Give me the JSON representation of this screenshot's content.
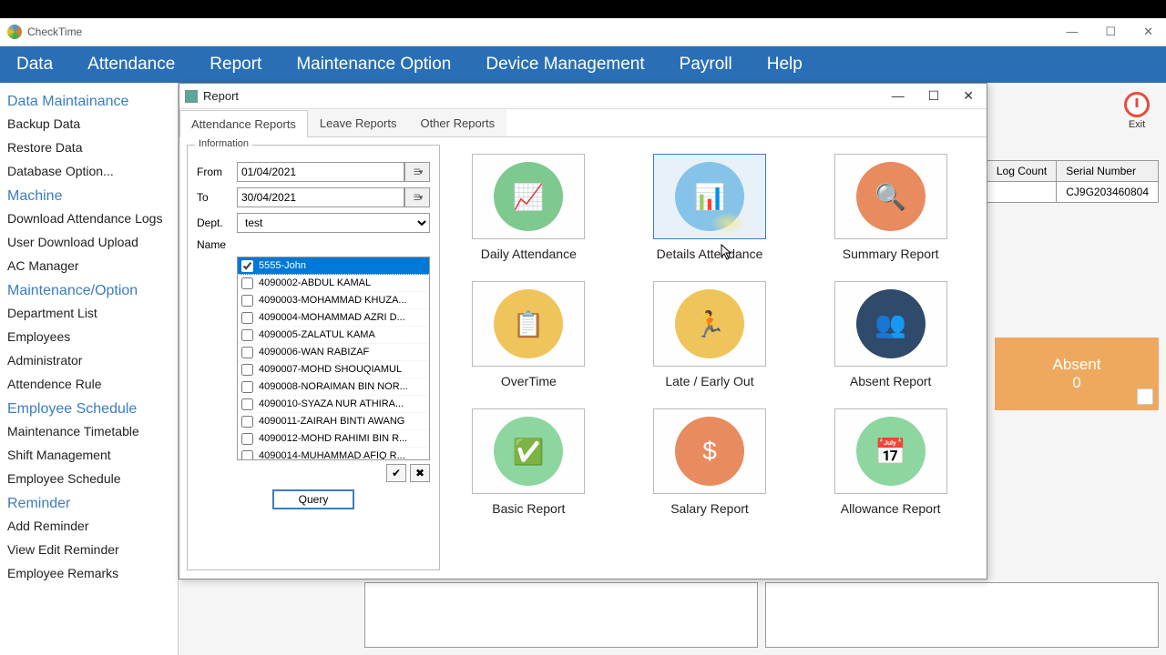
{
  "app": {
    "title": "CheckTime"
  },
  "menubar": [
    "Data",
    "Attendance",
    "Report",
    "Maintenance Option",
    "Device Management",
    "Payroll",
    "Help"
  ],
  "sidebar": [
    {
      "type": "head",
      "label": "Data Maintainance"
    },
    {
      "type": "item",
      "label": "Backup Data"
    },
    {
      "type": "item",
      "label": "Restore Data"
    },
    {
      "type": "item",
      "label": "Database Option..."
    },
    {
      "type": "head",
      "label": "Machine"
    },
    {
      "type": "item",
      "label": "Download Attendance Logs"
    },
    {
      "type": "item",
      "label": "User Download Upload"
    },
    {
      "type": "item",
      "label": "AC Manager"
    },
    {
      "type": "head",
      "label": "Maintenance/Option"
    },
    {
      "type": "item",
      "label": "Department List"
    },
    {
      "type": "item",
      "label": "Employees"
    },
    {
      "type": "item",
      "label": "Administrator"
    },
    {
      "type": "item",
      "label": "Attendence Rule"
    },
    {
      "type": "head",
      "label": "Employee Schedule"
    },
    {
      "type": "item",
      "label": "Maintenance Timetable"
    },
    {
      "type": "item",
      "label": "Shift Management"
    },
    {
      "type": "item",
      "label": "Employee Schedule"
    },
    {
      "type": "head",
      "label": "Reminder"
    },
    {
      "type": "item",
      "label": "Add Reminder"
    },
    {
      "type": "item",
      "label": "View Edit Reminder"
    },
    {
      "type": "item",
      "label": "Employee Remarks"
    }
  ],
  "exit": {
    "label": "Exit"
  },
  "bgtable": {
    "cols": [
      "Log Count",
      "Serial Number"
    ],
    "row": [
      "",
      "CJ9G203460804"
    ]
  },
  "absent": {
    "title": "Absent",
    "count": "0"
  },
  "modal": {
    "title": "Report",
    "tabs": [
      "Attendance Reports",
      "Leave Reports",
      "Other Reports"
    ],
    "activeTab": 0,
    "info": {
      "legend": "Information",
      "fromLabel": "From",
      "fromValue": "01/04/2021",
      "toLabel": "To",
      "toValue": "30/04/2021",
      "deptLabel": "Dept.",
      "deptValue": "test",
      "nameLabel": "Name",
      "names": [
        {
          "checked": true,
          "selected": true,
          "label": "5555-John"
        },
        {
          "checked": false,
          "selected": false,
          "label": "4090002-ABDUL KAMAL"
        },
        {
          "checked": false,
          "selected": false,
          "label": "4090003-MOHAMMAD KHUZA..."
        },
        {
          "checked": false,
          "selected": false,
          "label": "4090004-MOHAMMAD AZRI D..."
        },
        {
          "checked": false,
          "selected": false,
          "label": "4090005-ZALATUL KAMA"
        },
        {
          "checked": false,
          "selected": false,
          "label": "4090006-WAN RABIZAF"
        },
        {
          "checked": false,
          "selected": false,
          "label": "4090007-MOHD SHOUQIAMUL"
        },
        {
          "checked": false,
          "selected": false,
          "label": "4090008-NORAIMAN BIN NOR..."
        },
        {
          "checked": false,
          "selected": false,
          "label": "4090010-SYAZA NUR ATHIRA..."
        },
        {
          "checked": false,
          "selected": false,
          "label": "4090011-ZAIRAH BINTI AWANG"
        },
        {
          "checked": false,
          "selected": false,
          "label": "4090012-MOHD RAHIMI BIN R..."
        },
        {
          "checked": false,
          "selected": false,
          "label": "4090014-MUHAMMAD AFIQ R..."
        }
      ],
      "queryLabel": "Query"
    },
    "reports": [
      {
        "label": "Daily Attendance",
        "color": "c-green",
        "glyph": "📈"
      },
      {
        "label": "Details Attendance",
        "color": "c-blue",
        "glyph": "📊",
        "hover": true
      },
      {
        "label": "Summary Report",
        "color": "c-orange",
        "glyph": "🔍"
      },
      {
        "label": "OverTime",
        "color": "c-yellow",
        "glyph": "📋"
      },
      {
        "label": "Late / Early Out",
        "color": "c-yellow",
        "glyph": "🏃"
      },
      {
        "label": "Absent Report",
        "color": "c-navy",
        "glyph": "👥"
      },
      {
        "label": "Basic Report",
        "color": "c-lgreen",
        "glyph": "✅"
      },
      {
        "label": "Salary Report",
        "color": "c-orange",
        "glyph": "$"
      },
      {
        "label": "Allowance Report",
        "color": "c-lgreen",
        "glyph": "📅"
      }
    ]
  }
}
